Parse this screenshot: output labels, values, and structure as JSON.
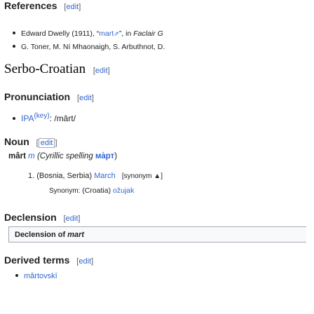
{
  "references": {
    "heading": "References",
    "edit": "edit",
    "items": [
      {
        "author": "Edward Dwelly (1911), “",
        "link": "mart",
        "ext": "⇗",
        "tail": "”, in ",
        "source": "Faclair G"
      },
      {
        "text": "G. Toner, M. Ní Mhaonaigh, S. Arbuthnot, D."
      }
    ]
  },
  "language": {
    "heading": "Serbo-Croatian",
    "edit": "edit"
  },
  "pronunciation": {
    "heading": "Pronunciation",
    "edit": "edit",
    "ipa_label": "IPA",
    "key": "(key)",
    "ipa": ": /mârt/"
  },
  "noun": {
    "heading": "Noun",
    "edit": "edit",
    "headword": "mârt",
    "gender": "m",
    "cyrillic_prefix": "(Cyrillic spelling ",
    "cyrillic": "ма̀рт",
    "cyrillic_suffix": ")",
    "sense_number": "1.",
    "sense_label": "(Bosnia, Serbia)",
    "sense_text": "March",
    "synonym_tag": "[synonym ▲]",
    "synonym_prefix": "Synonym: ",
    "synonym_context": "(Croatia)",
    "synonym_word": "ožujak"
  },
  "declension": {
    "heading": "Declension",
    "edit": "edit",
    "box_title": "Declension of mart"
  },
  "derived": {
    "heading": "Derived terms",
    "edit": "edit",
    "items": [
      "mârtovskī"
    ]
  }
}
